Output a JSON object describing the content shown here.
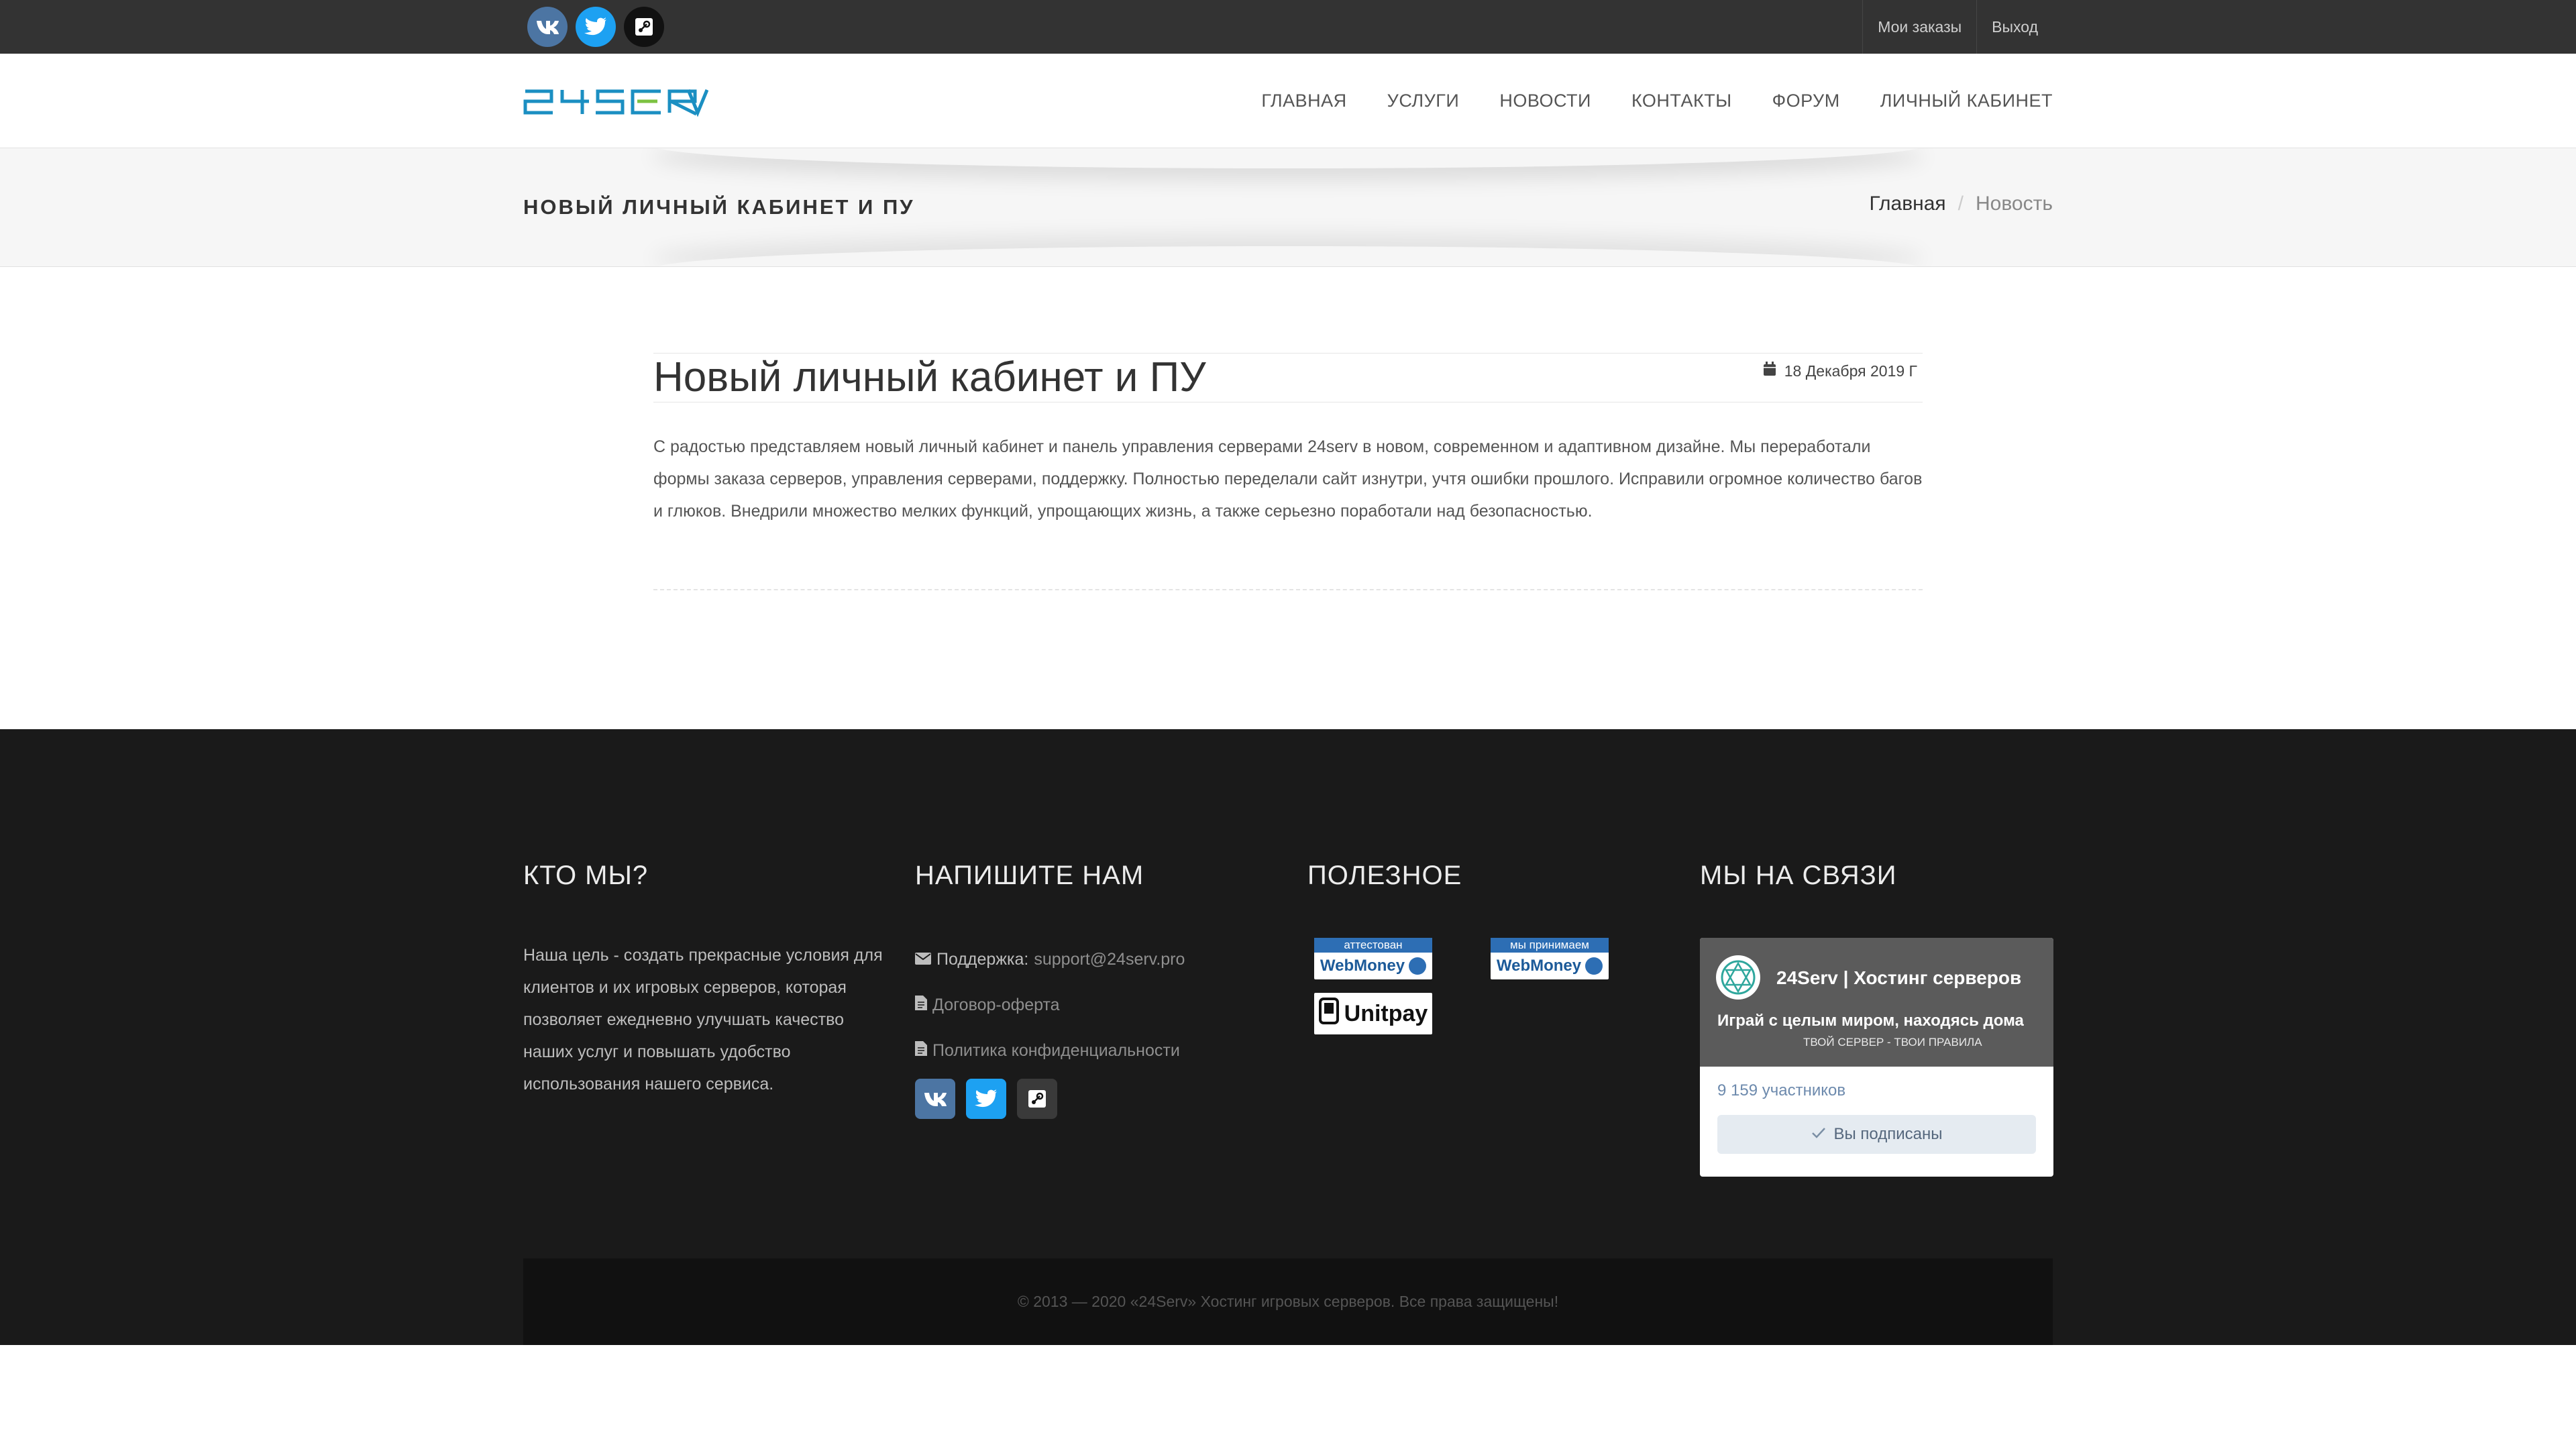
{
  "topbar": {
    "social": [
      {
        "icon": "vk-icon",
        "color": "#4c75a3"
      },
      {
        "icon": "twitter-icon",
        "color": "#1da1f2"
      },
      {
        "icon": "steam-icon",
        "color": "#111111"
      }
    ],
    "my_orders": "Мои заказы",
    "logout": "Выход"
  },
  "header": {
    "logo_text": "24SERV",
    "nav": [
      "ГЛАВНАЯ",
      "УСЛУГИ",
      "НОВОСТИ",
      "КОНТАКТЫ",
      "ФОРУМ",
      "ЛИЧНЫЙ КАБИНЕТ"
    ]
  },
  "pagebar": {
    "title": "НОВЫЙ ЛИЧНЫЙ КАБИНЕТ И ПУ",
    "breadcrumb_home": "Главная",
    "breadcrumb_sep": "/",
    "breadcrumb_current": "Новость"
  },
  "article": {
    "title": "Новый личный кабинет и ПУ",
    "date": "18 Декабря 2019 Г",
    "body": "С радостью представляем новый личный кабинет и панель управления серверами 24serv в новом, современном и адаптивном дизайне. Мы переработали формы заказа серверов, управления серверами, поддержку. Полностью переделали сайт изнутри, учтя ошибки прошлого. Исправили огромное количество багов и глюков. Внедрили множество мелких функций, упрощающих жизнь, а также серьезно поработали над безопасностью."
  },
  "footer": {
    "about": {
      "heading": "КТО МЫ?",
      "text": "Наша цель - создать прекрасные условия для клиентов и их игровых серверов, которая позволяет ежедневно улучшать качество наших услуг и повышать удобство использования нашего сервиса."
    },
    "contact": {
      "heading": "НАПИШИТЕ НАМ",
      "support_label": "Поддержка:",
      "support_email": "support@24serv.pro",
      "offer": "Договор-оферта",
      "privacy": "Политика конфиденциальности"
    },
    "useful": {
      "heading": "ПОЛЕЗНОЕ",
      "wm1_top": "аттестован",
      "wm2_top": "мы принимаем",
      "wm_name": "WebMoney",
      "unitpay": "Unitpay"
    },
    "social": {
      "heading": "МЫ НА СВЯЗИ",
      "group_name": "24Serv | Хостинг серверов",
      "slogan": "Играй с целым миром, находясь дома",
      "cover_sub": "ТВОЙ СЕРВЕР - ТВОИ ПРАВИЛА",
      "members": "9 159 участников",
      "subscribed": "Вы подписаны"
    },
    "copyright": "© 2013 — 2020 «24Serv» Хостинг игровых серверов. Все права защищены!"
  }
}
